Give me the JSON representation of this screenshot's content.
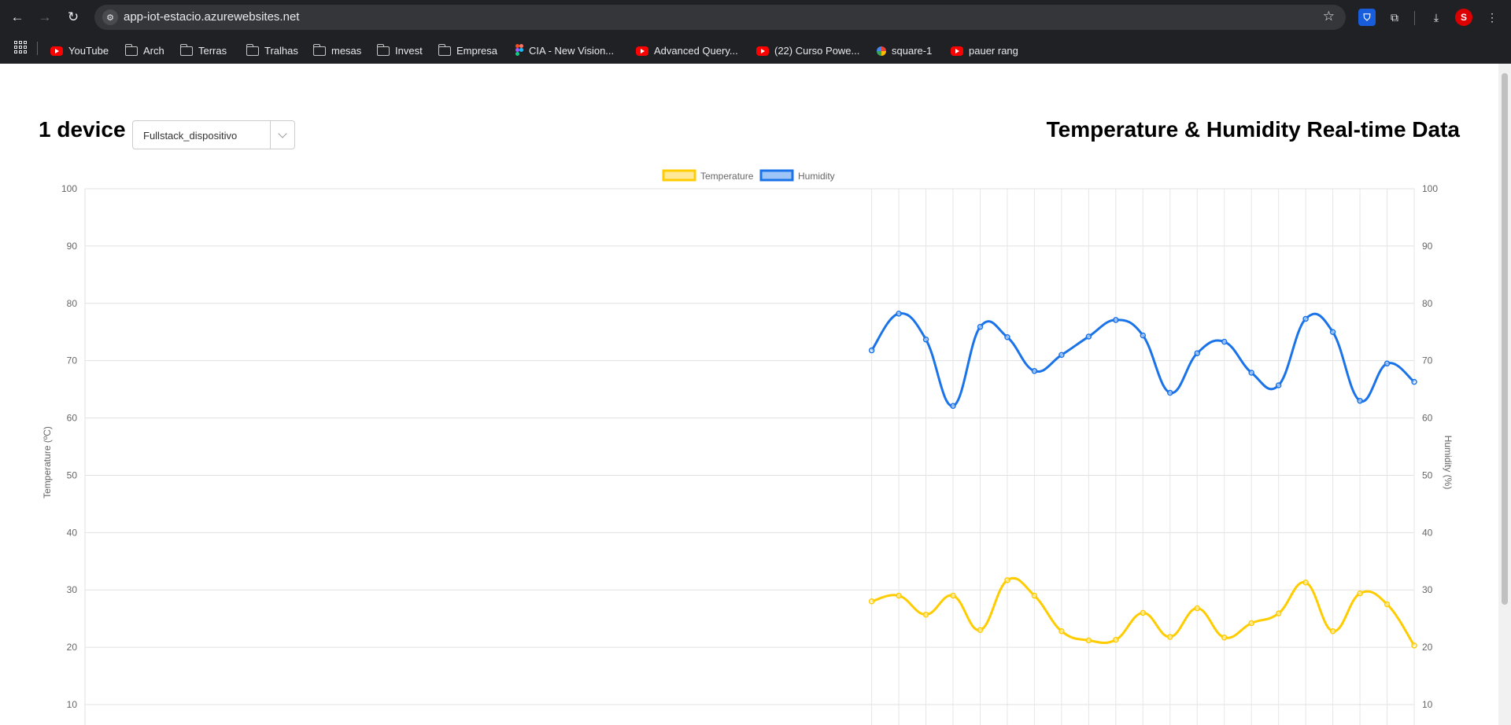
{
  "browser": {
    "url": "app-iot-estacio.azurewebsites.net",
    "bookmarks": [
      {
        "label": "YouTube",
        "icon": "youtube-icon"
      },
      {
        "label": "Arch",
        "icon": "folder-icon"
      },
      {
        "label": "Terras",
        "icon": "folder-icon"
      },
      {
        "label": "Tralhas",
        "icon": "folder-icon"
      },
      {
        "label": "mesas",
        "icon": "folder-icon"
      },
      {
        "label": "Invest",
        "icon": "folder-icon"
      },
      {
        "label": "Empresa",
        "icon": "folder-icon"
      },
      {
        "label": "CIA - New Vision...",
        "icon": "figma-icon"
      },
      {
        "label": "Advanced Query...",
        "icon": "youtube-icon"
      },
      {
        "label": "(22) Curso Powe...",
        "icon": "youtube-icon"
      },
      {
        "label": "square-1",
        "icon": "square-icon"
      },
      {
        "label": "pauer rang",
        "icon": "youtube-icon"
      }
    ]
  },
  "header": {
    "device_count": "1 device",
    "selected_device": "Fullstack_dispositivo",
    "title": "Temperature & Humidity Real-time Data"
  },
  "chart_data": {
    "type": "line",
    "legend": [
      "Temperature",
      "Humidity"
    ],
    "legend_position": "top-center",
    "y_left_label": "Temperature (ºC)",
    "y_right_label": "Humidity (%)",
    "ylim_left": [
      10,
      100
    ],
    "ylim_right": [
      10,
      100
    ],
    "y_ticks": [
      100,
      90,
      80,
      70,
      60,
      50,
      40,
      30,
      20,
      10
    ],
    "grid": true,
    "slots_total": 50,
    "first_filled_slot": 29,
    "colors": {
      "temperature": "#ffcc00",
      "humidity": "#1a73e8"
    },
    "series": [
      {
        "name": "Temperature",
        "values": [
          28,
          29,
          25.7,
          29,
          23,
          31.7,
          29,
          22.8,
          21.2,
          21.3,
          26,
          21.8,
          26.8,
          21.7,
          24.2,
          25.9,
          31.3,
          22.8,
          29.4,
          27.5,
          20.3
        ]
      },
      {
        "name": "Humidity",
        "values": [
          71.8,
          78.2,
          73.7,
          62.1,
          75.9,
          74.1,
          68.2,
          71,
          74.2,
          77.1,
          74.4,
          64.4,
          71.3,
          73.3,
          67.9,
          65.7,
          77.3,
          75,
          63,
          69.5,
          66.3
        ]
      }
    ]
  }
}
